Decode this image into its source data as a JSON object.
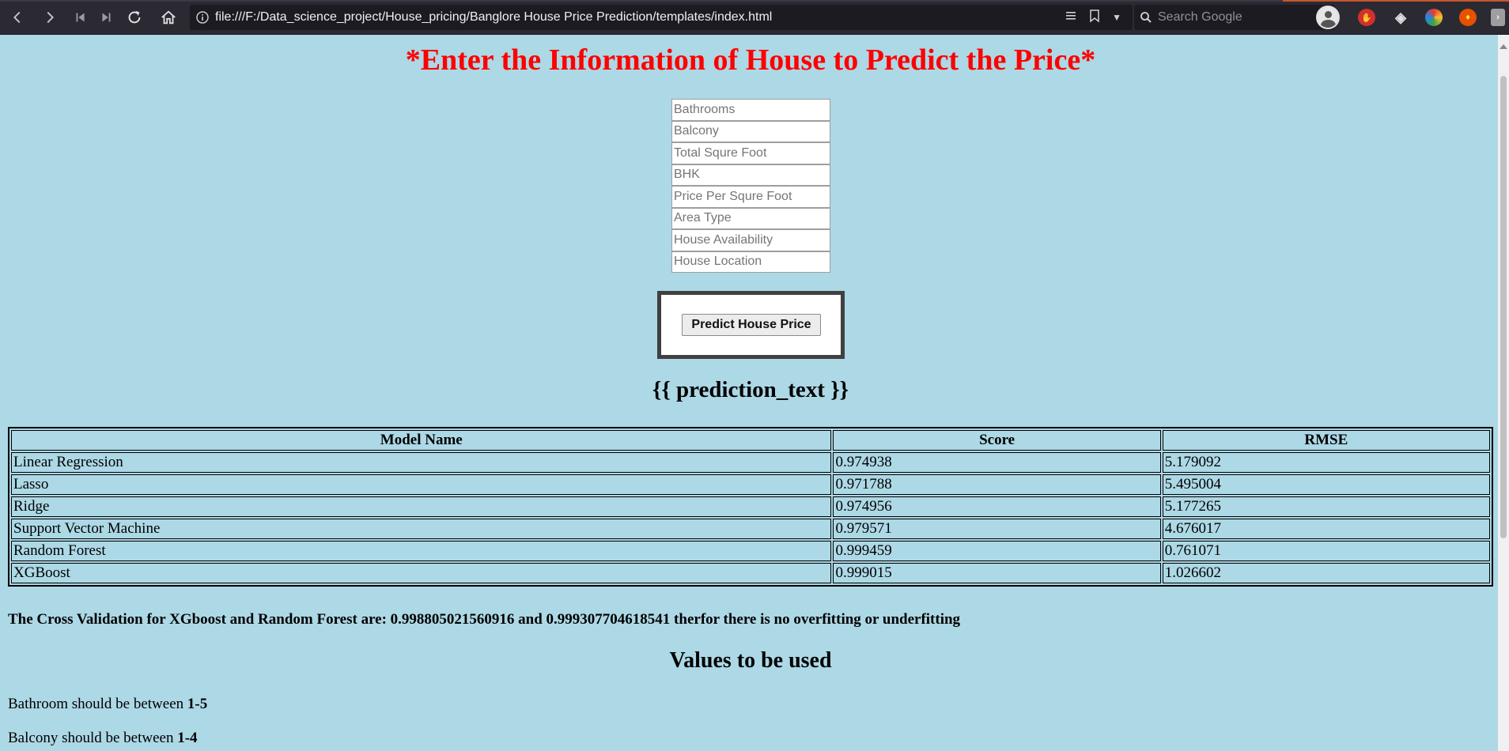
{
  "browser": {
    "url": "file:///F:/Data_science_project/House_pricing/Banglore House Price Prediction/templates/index.html",
    "search_placeholder": "Search Google"
  },
  "page": {
    "title": "*Enter the Information of House to Predict the Price*",
    "fields": [
      {
        "placeholder": "Bathrooms"
      },
      {
        "placeholder": "Balcony"
      },
      {
        "placeholder": "Total Squre Foot"
      },
      {
        "placeholder": "BHK"
      },
      {
        "placeholder": "Price Per Squre Foot"
      },
      {
        "placeholder": "Area Type"
      },
      {
        "placeholder": "House Availability"
      },
      {
        "placeholder": "House Location"
      }
    ],
    "predict_button": "Predict House Price",
    "prediction_text": "{{ prediction_text }}",
    "table": {
      "headers": [
        "Model Name",
        "Score",
        "RMSE"
      ],
      "rows": [
        [
          "Linear Regression",
          "0.974938",
          "5.179092"
        ],
        [
          "Lasso",
          "0.971788",
          "5.495004"
        ],
        [
          "Ridge",
          "0.974956",
          "5.177265"
        ],
        [
          "Support Vector Machine",
          "0.979571",
          "4.676017"
        ],
        [
          "Random Forest",
          "0.999459",
          "0.761071"
        ],
        [
          "XGBoost",
          "0.999015",
          "1.026602"
        ]
      ]
    },
    "cross_validation": "The Cross Validation for XGboost and Random Forest are: 0.998805021560916 and 0.999307704618541 therfor there is no overfitting or underfitting",
    "values_heading": "Values to be used",
    "rules": [
      {
        "text": "Bathroom should be between ",
        "range": "1-5"
      },
      {
        "text": "Balcony should be between ",
        "range": "1-4"
      }
    ]
  },
  "colors": {
    "page_bg": "#add8e6",
    "title": "#ff0000"
  }
}
